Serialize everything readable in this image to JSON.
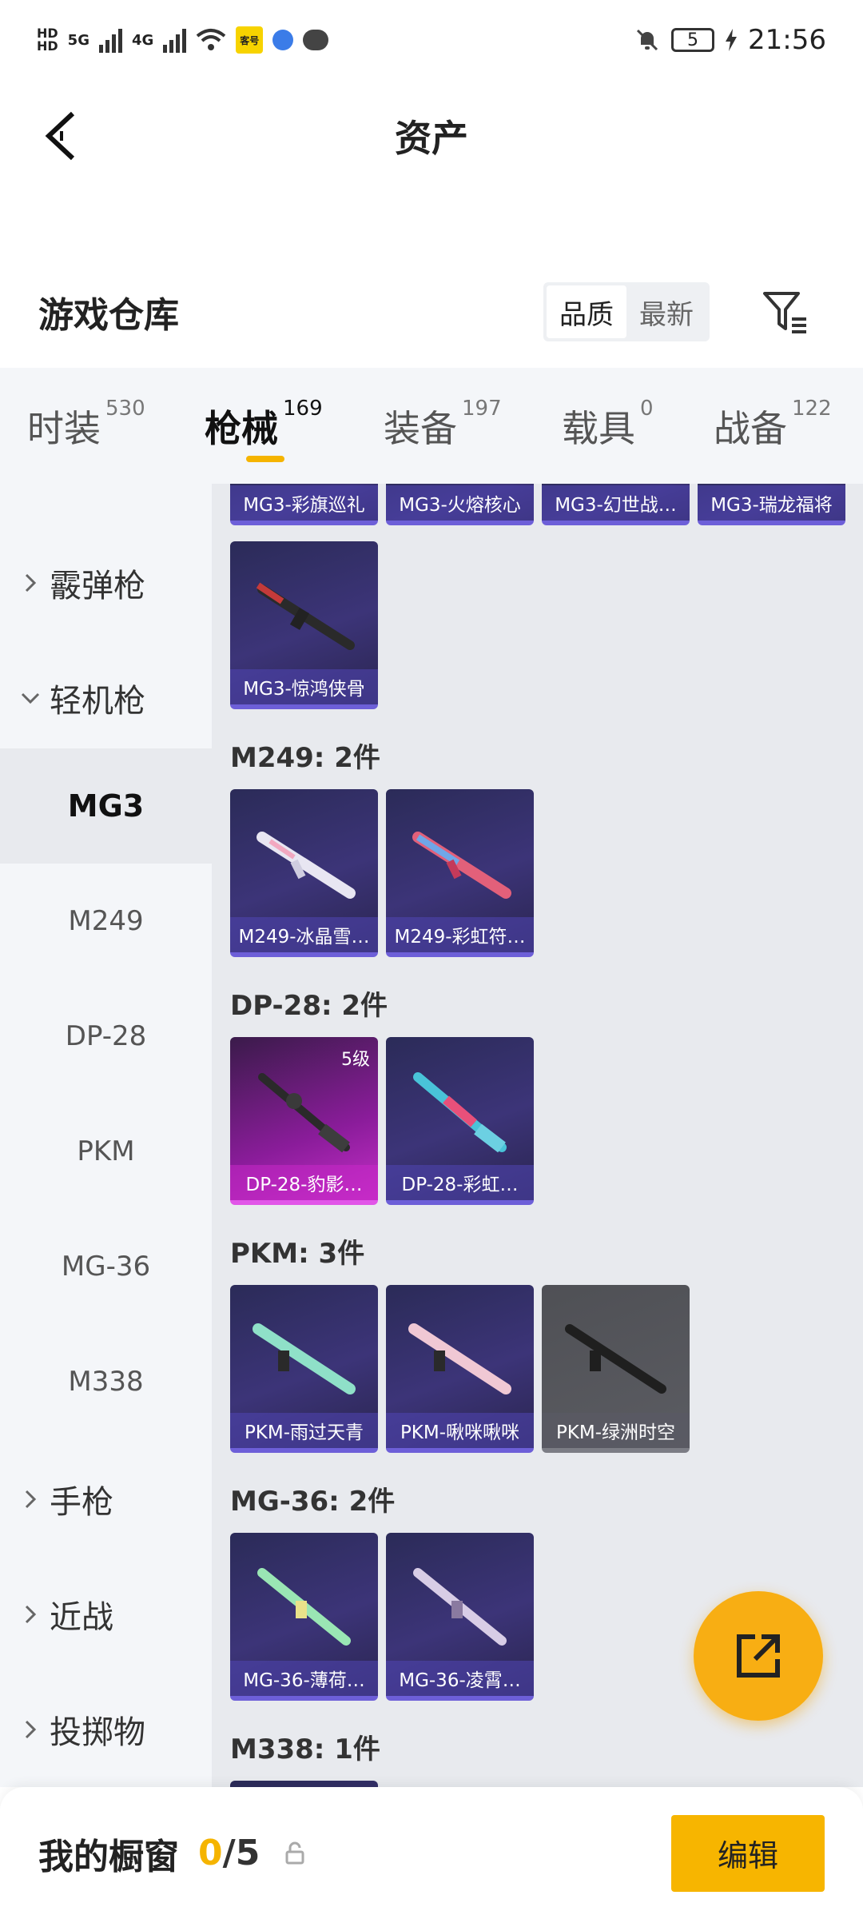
{
  "status": {
    "time": "21:56",
    "battery": "5",
    "net_5g": "5G",
    "net_4g": "4G",
    "hd1": "HD",
    "hd2": "HD",
    "badge": "客号"
  },
  "header": {
    "title": "资产"
  },
  "warehouse": {
    "title": "游戏仓库",
    "sort_quality": "品质",
    "sort_newest": "最新"
  },
  "tabs": [
    {
      "label": "时装",
      "count": "530"
    },
    {
      "label": "枪械",
      "count": "169"
    },
    {
      "label": "装备",
      "count": "197"
    },
    {
      "label": "载具",
      "count": "0"
    },
    {
      "label": "战备",
      "count": "122"
    }
  ],
  "sidebar": {
    "cat_shotgun": "霰弹枪",
    "cat_lmg": "轻机枪",
    "subs": [
      "MG3",
      "M249",
      "DP-28",
      "PKM",
      "MG-36",
      "M338"
    ],
    "cat_pistol": "手枪",
    "cat_melee": "近战",
    "cat_throw": "投掷物"
  },
  "sections": {
    "top_row": [
      "MG3-彩旗巡礼",
      "MG3-火熔核心",
      "MG3-幻世战…",
      "MG3-瑞龙福将"
    ],
    "mg3_last": "MG3-惊鸿侠骨",
    "m249_title": "M249: 2件",
    "m249": [
      "M249-冰晶雪…",
      "M249-彩虹符…"
    ],
    "dp28_title": "DP-28: 2件",
    "dp28": [
      "DP-28-豹影…",
      "DP-28-彩虹…"
    ],
    "dp28_level": "5级",
    "pkm_title": "PKM: 3件",
    "pkm": [
      "PKM-雨过天青",
      "PKM-啾咪啾咪",
      "PKM-绿洲时空"
    ],
    "mg36_title": "MG-36: 2件",
    "mg36": [
      "MG-36-薄荷…",
      "MG-36-凌霄…"
    ],
    "m338_title": "M338: 1件"
  },
  "bottom": {
    "label": "我的橱窗",
    "current": "0",
    "sep_total": "/5",
    "edit": "编辑"
  }
}
